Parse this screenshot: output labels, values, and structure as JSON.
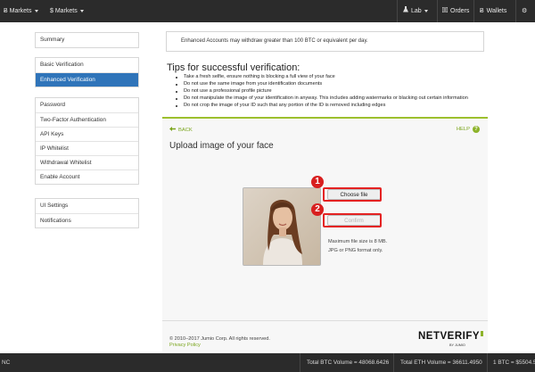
{
  "topbar": {
    "btc_markets": "Ƀ Markets",
    "usd_markets": "$ Markets",
    "lab": "Lab",
    "orders": "Orders",
    "wallets": "Wallets",
    "settings_icon": "gear-icon"
  },
  "sidebar": {
    "group1": [
      {
        "label": "Summary",
        "active": false
      }
    ],
    "group2": [
      {
        "label": "Basic Verification",
        "active": false
      },
      {
        "label": "Enhanced Verification",
        "active": true
      }
    ],
    "group3": [
      {
        "label": "Password"
      },
      {
        "label": "Two-Factor Authentication"
      },
      {
        "label": "API Keys"
      },
      {
        "label": "IP Whitelist"
      },
      {
        "label": "Withdrawal Whitelist"
      },
      {
        "label": "Enable Account"
      }
    ],
    "group4": [
      {
        "label": "UI Settings"
      },
      {
        "label": "Notifications"
      }
    ]
  },
  "notice": "Enhanced Accounts may withdraw greater than 100 BTC or equivalent per day.",
  "tips": {
    "title": "Tips for successful verification:",
    "items": [
      "Take a fresh selfie, ensure nothing is blocking a full view of your face",
      "Do not use the same image from your identification documents",
      "Do not use a professional profile picture",
      "Do not manipulate the image of your identification in anyway.",
      "Do not crop the image of your ID such that any portion of the ID is removed including edges"
    ],
    "item4_full": "Do not manipulate the image of your identification in anyway. This includes adding watermarks or blacking out certain information"
  },
  "netverify": {
    "back": "BACK",
    "help": "HELP",
    "help_glyph": "?",
    "upload_title": "Upload image of your face",
    "choose_file": "Choose file",
    "confirm": "Confirm",
    "badge1": "1",
    "badge2": "2",
    "max_size": "Maximum file size is 8 MB.",
    "format": "JPG or PNG format only.",
    "copyright": "© 2010–2017 Jumio Corp. All rights reserved.",
    "privacy": "Privacy Policy",
    "logo": "NETVERIFY",
    "logo_sub": "BY JUMIO"
  },
  "bottombar": {
    "left": "NC",
    "btc_volume": "Total BTC Volume = 48068.6426",
    "eth_volume": "Total ETH Volume = 36611.4950",
    "btc_price": "1 BTC = $5504.5"
  },
  "colors": {
    "active": "#2f74b9",
    "accent_green": "#9dc02e",
    "annotation_red": "#e42222"
  }
}
